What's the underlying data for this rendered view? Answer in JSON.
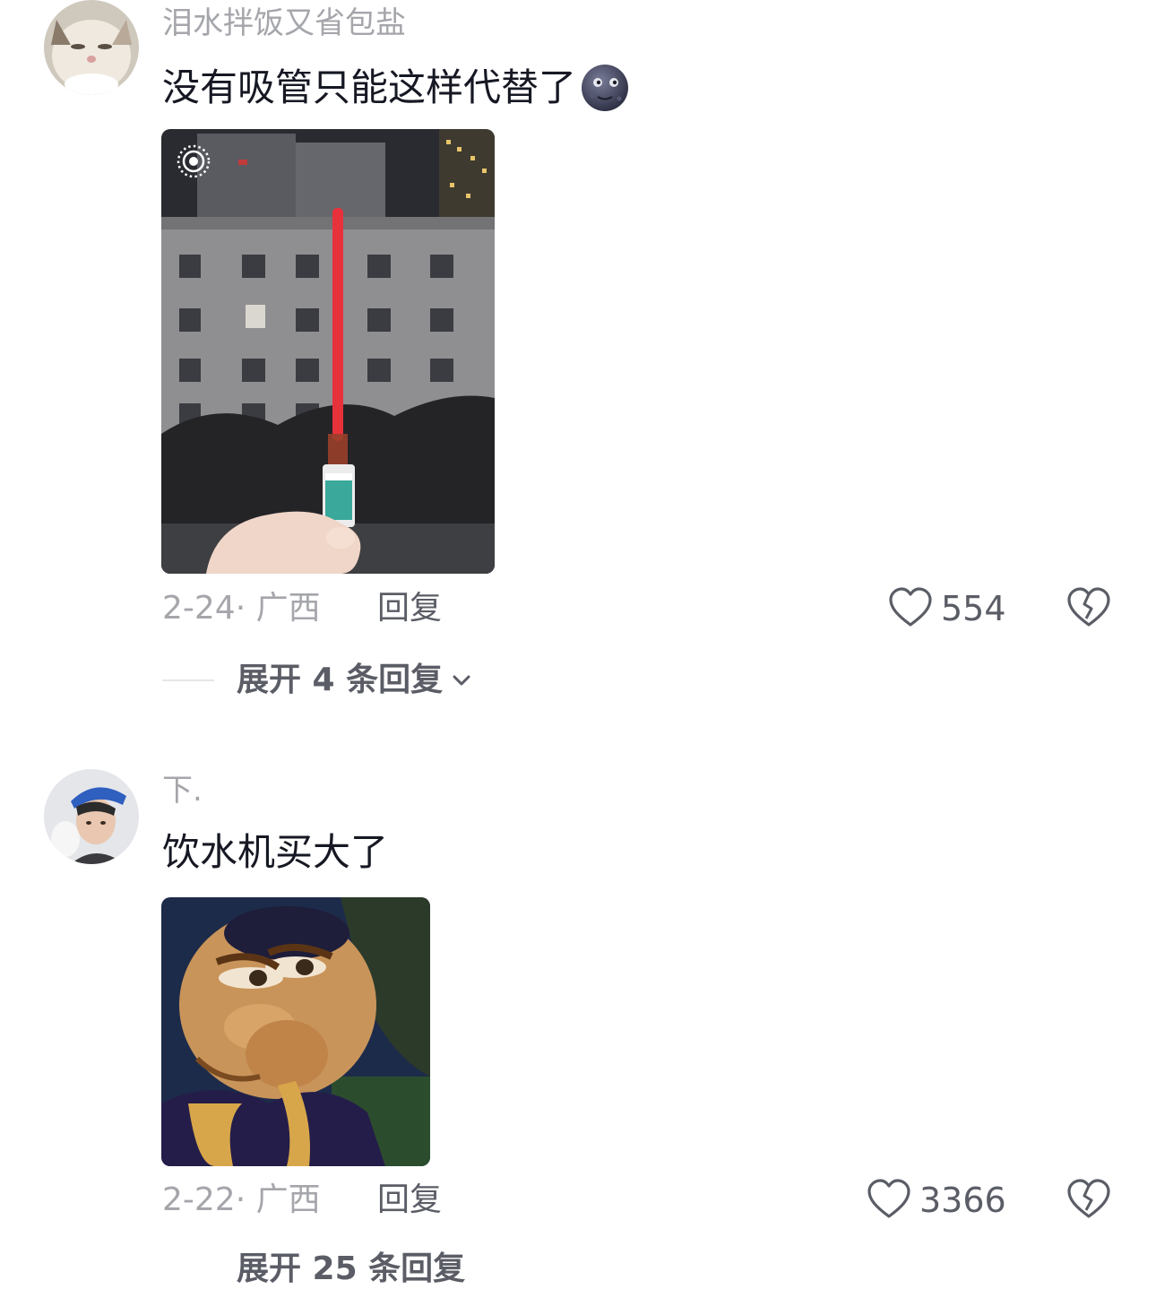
{
  "comments": [
    {
      "username": "泪水拌饭又省包盐",
      "text": "没有吸管只能这样代替了",
      "emoji": "new-moon-face-emoji",
      "image_subject": "photo-straw-on-medicine-vial",
      "time_location": "2-24· 广西",
      "reply_label": "回复",
      "like_count": "554",
      "expand_label": "展开 4 条回复"
    },
    {
      "username": "下.",
      "text": "饮水机买大了",
      "image_subject": "cartoon-face-meme",
      "time_location": "2-22· 广西",
      "reply_label": "回复",
      "like_count": "3366",
      "expand_label": "展开 25 条回复"
    }
  ],
  "icons": {
    "like": "heart-outline-icon",
    "dislike": "broken-heart-icon",
    "expand": "chevron-down-icon",
    "live_photo": "live-photo-icon"
  },
  "colors": {
    "username": "#a5a6ab",
    "text": "#161823",
    "secondary": "#5b5d66",
    "straw": "#e8323b"
  }
}
